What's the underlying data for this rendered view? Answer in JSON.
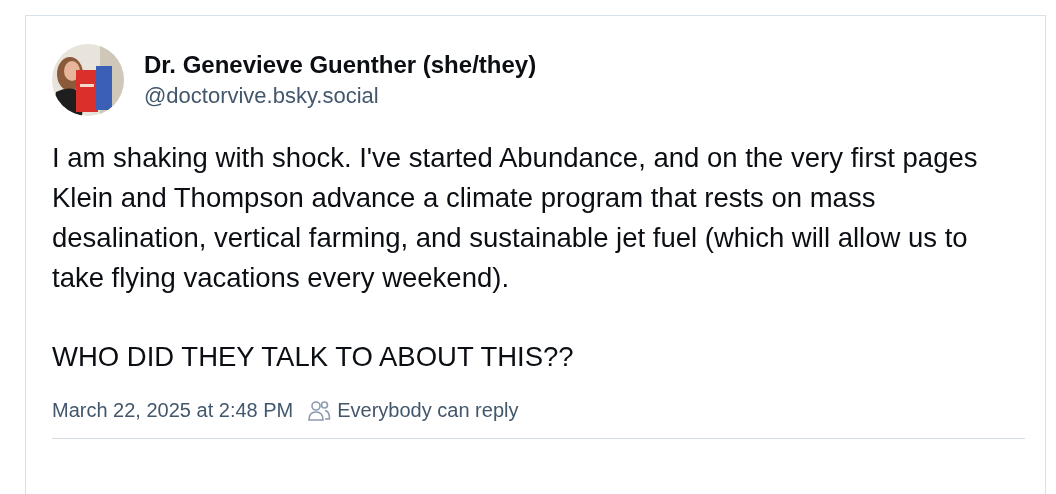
{
  "post": {
    "author": {
      "name": "Dr. Genevieve Guenther (she/they)",
      "handle": "@doctorvive.bsky.social"
    },
    "paragraphs": [
      "I am shaking with shock. I've started Abundance, and on the very first pages Klein and Thompson advance a climate program that rests on mass desalination, vertical farming, and sustainable jet fuel (which will allow us to take flying vacations every weekend).",
      "WHO DID THEY TALK TO ABOUT THIS??"
    ],
    "timestamp": "March 22, 2025 at 2:48 PM",
    "reply_setting": "Everybody can reply"
  }
}
